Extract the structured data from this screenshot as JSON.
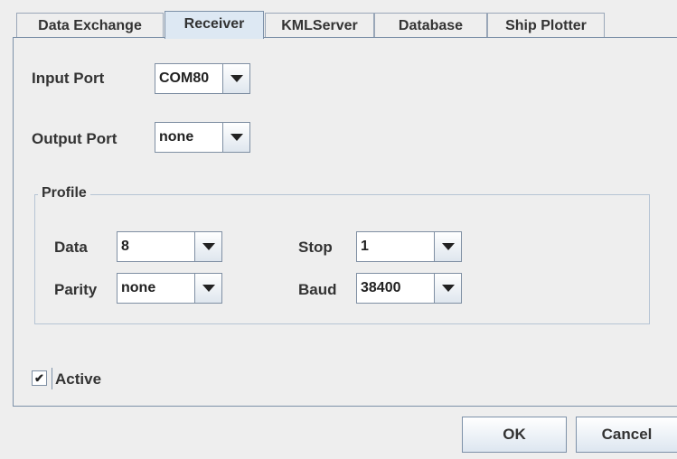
{
  "tabs": [
    {
      "label": "Data Exchange",
      "selected": false
    },
    {
      "label": "Receiver",
      "selected": true
    },
    {
      "label": "KMLServer",
      "selected": false
    },
    {
      "label": "Database",
      "selected": false
    },
    {
      "label": "Ship Plotter",
      "selected": false
    }
  ],
  "receiver": {
    "input_port": {
      "label": "Input Port",
      "value": "COM80"
    },
    "output_port": {
      "label": "Output Port",
      "value": "none"
    },
    "profile": {
      "title": "Profile",
      "data": {
        "label": "Data",
        "value": "8"
      },
      "stop": {
        "label": "Stop",
        "value": "1"
      },
      "parity": {
        "label": "Parity",
        "value": "none"
      },
      "baud": {
        "label": "Baud",
        "value": "38400"
      }
    },
    "active": {
      "label": "Active",
      "checked": true,
      "check_glyph": "✔"
    }
  },
  "buttons": {
    "ok": "OK",
    "cancel": "Cancel"
  }
}
